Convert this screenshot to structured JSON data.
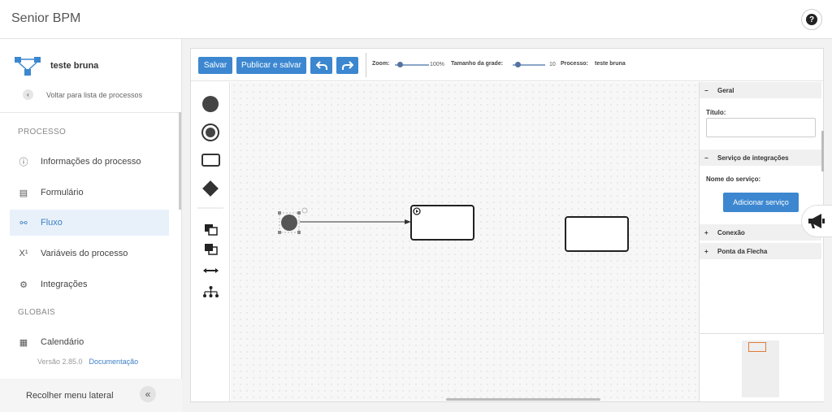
{
  "app": {
    "title": "Senior BPM",
    "help_icon": "question-circle-icon"
  },
  "sidebar": {
    "process_name": "teste bruna",
    "back_label": "Voltar para lista de processos",
    "section_process": "PROCESSO",
    "section_global": "GLOBAIS",
    "items": [
      {
        "label": "Informações do processo",
        "icon": "info-circle-icon"
      },
      {
        "label": "Formulário",
        "icon": "form-icon"
      },
      {
        "label": "Fluxo",
        "icon": "flow-icon",
        "active": true
      },
      {
        "label": "Variáveis do processo",
        "icon": "variable-icon"
      },
      {
        "label": "Integrações",
        "icon": "gears-icon"
      }
    ],
    "global_items": [
      {
        "label": "Calendário",
        "icon": "calendar-icon"
      }
    ],
    "version": "Versão 2.85.0",
    "doc_link": "Documentação",
    "collapse_label": "Recolher menu lateral"
  },
  "toolbar": {
    "save_label": "Salvar",
    "publish_label": "Publicar e salvar",
    "zoom_label": "Zoom:",
    "zoom_value": "100%",
    "grid_label": "Tamanho da grade:",
    "grid_value": "10",
    "process_label": "Processo:",
    "process_value": "teste bruna"
  },
  "properties": {
    "general_header": "Geral",
    "title_label": "Título:",
    "title_value": "",
    "service_header": "Serviço de integrações",
    "service_name_label": "Nome do serviço:",
    "add_service_label": "Adicionar serviço",
    "connection_header": "Conexão",
    "arrow_header": "Ponta da Flecha"
  },
  "colors": {
    "accent": "#3c87d0",
    "active_bg": "#e8f1fa",
    "minimap_view": "#e07b39"
  }
}
